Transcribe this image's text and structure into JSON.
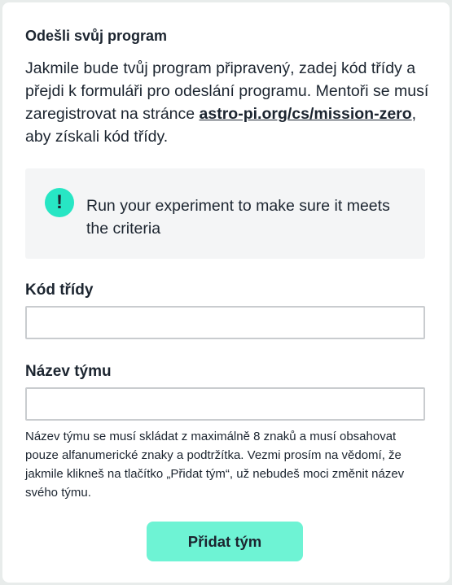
{
  "form": {
    "title": "Odešli svůj program",
    "intro_before_link": "Jakmile bude tvůj program připravený, zadej kód třídy a přejdi k formuláři pro odeslání programu. Mentoři se musí zaregistrovat na stránce ",
    "intro_link": "astro-pi.org/cs/mission-zero",
    "intro_after_link": ", aby získali kód třídy.",
    "callout": {
      "icon": "exclamation-icon",
      "icon_glyph": "!",
      "text": "Run your experiment to make sure it meets the criteria"
    },
    "class_code": {
      "label": "Kód třídy",
      "value": ""
    },
    "team_name": {
      "label": "Název týmu",
      "value": "",
      "hint": "Název týmu se musí skládat z maximálně 8 znaků a musí obsahovat pouze alfanumerické znaky a podtržítka. Vezmi prosím na vědomí, že jakmile klikneš na tlačítko „Přidat tým“, už nebudeš moci změnit název svého týmu."
    },
    "submit_label": "Přidat tým"
  },
  "colors": {
    "accent": "#27e6c4",
    "button": "#6ef3d4",
    "callout_bg": "#f4f5f6",
    "text": "#1c2530"
  }
}
